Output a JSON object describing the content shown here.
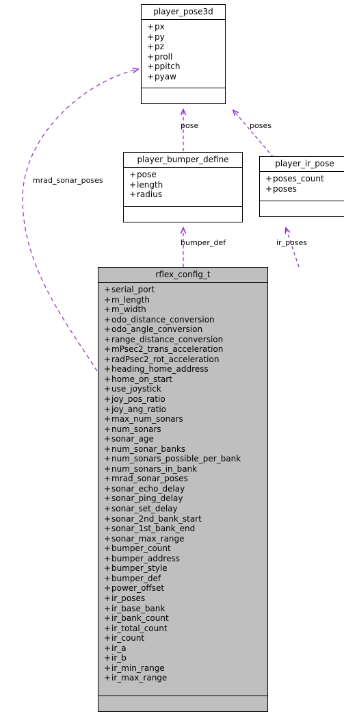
{
  "diagram": {
    "type": "uml-class-diagram",
    "background": "#ffffff",
    "edge_color": "#9a32cd",
    "border_color": "#000000",
    "highlight_fill": "#bfbfbf",
    "plus": "+"
  },
  "classes": {
    "player_pose3d": {
      "name": "player_pose3d",
      "attributes": [
        "px",
        "py",
        "pz",
        "proll",
        "ppitch",
        "pyaw"
      ]
    },
    "player_bumper_define": {
      "name": "player_bumper_define",
      "attributes": [
        "pose",
        "length",
        "radius"
      ]
    },
    "player_ir_pose": {
      "name": "player_ir_pose",
      "attributes": [
        "poses_count",
        "poses"
      ]
    },
    "rflex_config_t": {
      "name": "rflex_config_t",
      "attributes": [
        "serial_port",
        "m_length",
        "m_width",
        "odo_distance_conversion",
        "odo_angle_conversion",
        "range_distance_conversion",
        "mPsec2_trans_acceleration",
        "radPsec2_rot_acceleration",
        "heading_home_address",
        "home_on_start",
        "use_joystick",
        "joy_pos_ratio",
        "joy_ang_ratio",
        "max_num_sonars",
        "num_sonars",
        "sonar_age",
        "num_sonar_banks",
        "num_sonars_possible_per_bank",
        "num_sonars_in_bank",
        "mrad_sonar_poses",
        "sonar_echo_delay",
        "sonar_ping_delay",
        "sonar_set_delay",
        "sonar_2nd_bank_start",
        "sonar_1st_bank_end",
        "sonar_max_range",
        "bumper_count",
        "bumper_address",
        "bumper_style",
        "bumper_def",
        "power_offset",
        "ir_poses",
        "ir_base_bank",
        "ir_bank_count",
        "ir_total_count",
        "ir_count",
        "ir_a",
        "ir_b",
        "ir_min_range",
        "ir_max_range"
      ]
    }
  },
  "edges": [
    {
      "label": "pose",
      "from": "player_bumper_define",
      "to": "player_pose3d"
    },
    {
      "label": "poses",
      "from": "player_ir_pose",
      "to": "player_pose3d"
    },
    {
      "label": "mrad_sonar_poses",
      "from": "rflex_config_t",
      "to": "player_pose3d"
    },
    {
      "label": "bumper_def",
      "from": "rflex_config_t",
      "to": "player_bumper_define"
    },
    {
      "label": "ir_poses",
      "from": "rflex_config_t",
      "to": "player_ir_pose"
    }
  ]
}
